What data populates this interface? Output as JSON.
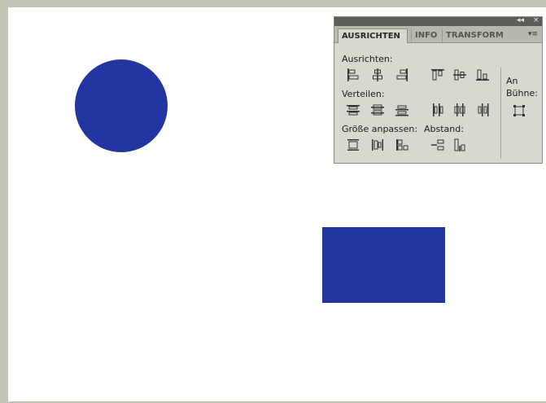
{
  "canvas": {
    "shape_color": "#2335a0",
    "stage_color": "#ffffff",
    "background_color": "#c3c3b8"
  },
  "panel": {
    "title_controls": {
      "collapse": "◂◂",
      "close": "×"
    },
    "tabs": [
      {
        "label": "AUSRICHTEN",
        "active": true
      },
      {
        "label": "INFO",
        "active": false
      },
      {
        "label": "TRANSFORM",
        "active": false
      }
    ],
    "menu_icon": "▾≡",
    "sections": {
      "align_label": "Ausrichten:",
      "distribute_label": "Verteilen:",
      "match_size_label": "Größe anpassen:",
      "spacing_label": "Abstand:",
      "to_stage_label_line1": "An",
      "to_stage_label_line2": "Bühne:"
    },
    "icons": {
      "align": [
        "align-left-edges-icon",
        "align-horizontal-centers-icon",
        "align-right-edges-icon",
        "align-top-edges-icon",
        "align-vertical-centers-icon",
        "align-bottom-edges-icon"
      ],
      "distribute": [
        "distribute-top-icon",
        "distribute-vcenter-icon",
        "distribute-bottom-icon",
        "distribute-left-icon",
        "distribute-hcenter-icon",
        "distribute-right-icon"
      ],
      "match_size": [
        "match-width-icon",
        "match-height-icon",
        "match-width-height-icon"
      ],
      "spacing": [
        "space-vertically-icon",
        "space-horizontally-icon"
      ],
      "stage": "align-to-stage-icon"
    }
  }
}
